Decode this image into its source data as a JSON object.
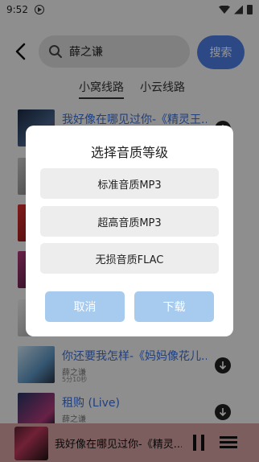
{
  "status_bar": {
    "time": "9:52"
  },
  "header": {
    "search_value": "薛之谦",
    "search_button": "搜索"
  },
  "tabs": [
    "小窝线路",
    "小云线路"
  ],
  "songs": [
    {
      "title": "我好像在哪见过你-《精灵王...",
      "artist": "",
      "duration": "",
      "color": "#23324a"
    },
    {
      "title": "",
      "artist": "",
      "duration": "",
      "color": "#9a9a9a"
    },
    {
      "title": "",
      "artist": "",
      "duration": "",
      "color": "#b02424"
    },
    {
      "title": "",
      "artist": "",
      "duration": "",
      "color": "#7d2b52"
    },
    {
      "title": "",
      "artist": "",
      "duration": "",
      "color": "#d9d9d9"
    },
    {
      "title": "你还要我怎样-《妈妈像花儿...",
      "artist": "薛之谦",
      "duration": "5分10秒",
      "color": "#7fb6d8"
    },
    {
      "title": "租购 (Live)",
      "artist": "薛之谦",
      "duration": "",
      "color": "#2b3b6b"
    }
  ],
  "player": {
    "title": "我好像在哪见过你-《精灵..."
  },
  "dialog": {
    "title": "选择音质等级",
    "options": [
      "标准音质MP3",
      "超高音质MP3",
      "无损音质FLAC"
    ],
    "cancel": "取消",
    "download": "下载"
  }
}
